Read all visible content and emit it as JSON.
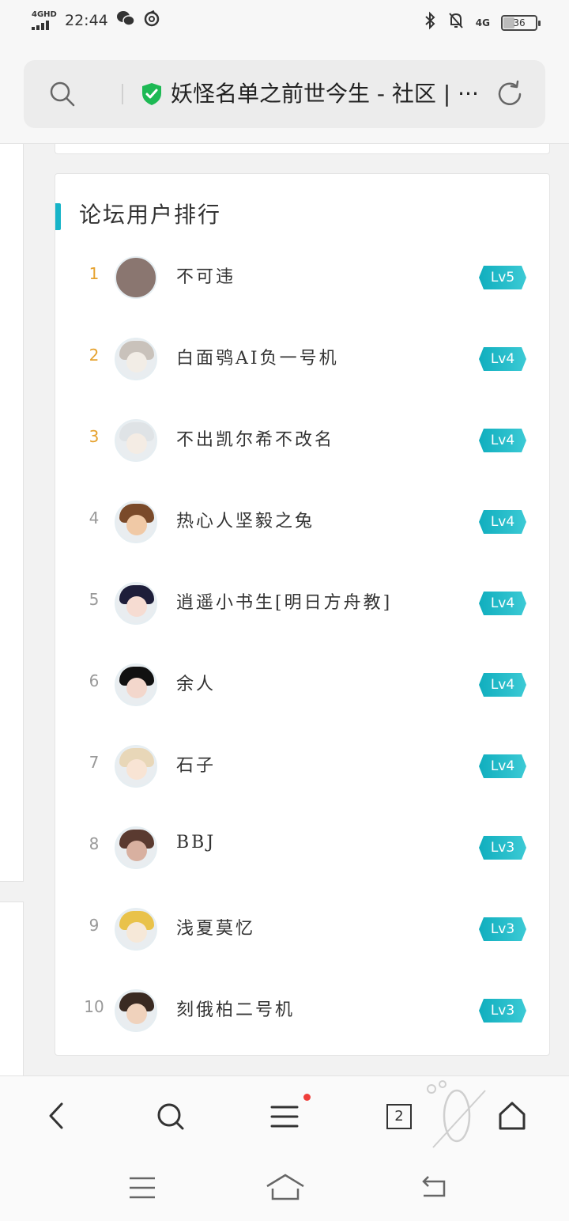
{
  "status_bar": {
    "network": "4GHD",
    "time": "22:44",
    "network_right": "4G",
    "battery": "36"
  },
  "address_bar": {
    "title": "妖怪名单之前世今生 - 社区 | ···"
  },
  "ranking": {
    "title": "论坛用户排行",
    "users": [
      {
        "rank": "1",
        "name": "不可违",
        "level": "Lv5"
      },
      {
        "rank": "2",
        "name": "白面鸮AI负一号机",
        "level": "Lv4"
      },
      {
        "rank": "3",
        "name": "不出凯尔希不改名",
        "level": "Lv4"
      },
      {
        "rank": "4",
        "name": "热心人坚毅之兔",
        "level": "Lv4"
      },
      {
        "rank": "5",
        "name": "逍遥小书生[明日方舟教]",
        "level": "Lv4"
      },
      {
        "rank": "6",
        "name": "余人",
        "level": "Lv4"
      },
      {
        "rank": "7",
        "name": "石子",
        "level": "Lv4"
      },
      {
        "rank": "8",
        "name": "BBJ",
        "level": "Lv3"
      },
      {
        "rank": "9",
        "name": "浅夏莫忆",
        "level": "Lv3"
      },
      {
        "rank": "10",
        "name": "刻俄柏二号机",
        "level": "Lv3"
      }
    ]
  },
  "bottom_bar": {
    "tabs_count": "2"
  },
  "colors": {
    "accent": "#17b4c8",
    "top_rank": "#e6a22f",
    "badge": "#10aebe",
    "notification_dot": "#ef3e3a",
    "secure_shield": "#1db954"
  }
}
